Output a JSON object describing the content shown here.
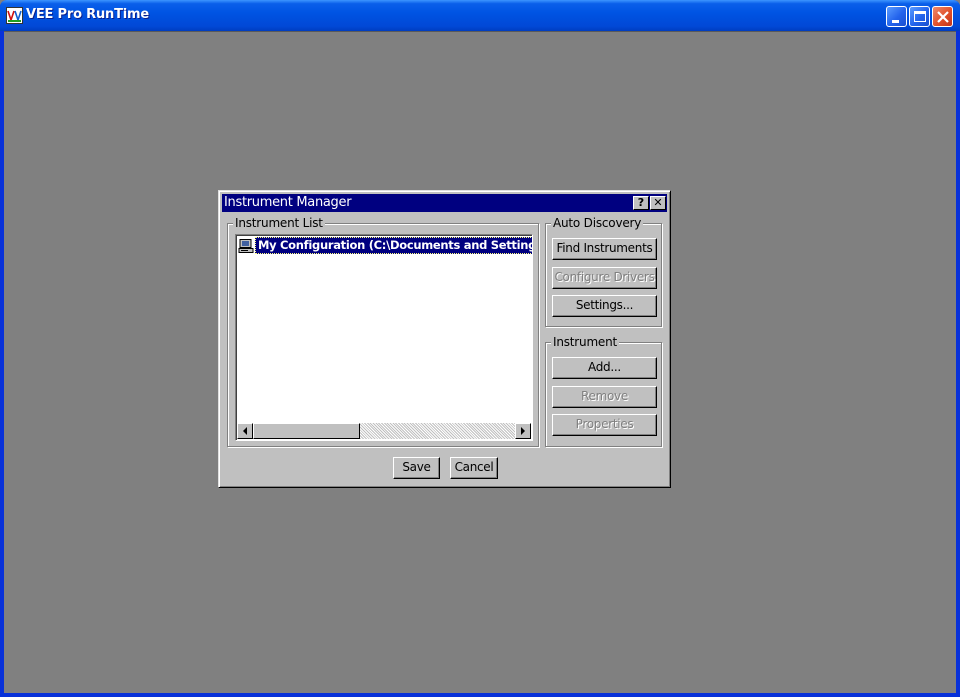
{
  "app": {
    "title": "VEE Pro RunTime",
    "window_controls": [
      "minimize-icon",
      "maximize-icon",
      "close-icon"
    ]
  },
  "dialog": {
    "title": "Instrument Manager",
    "help_label": "?",
    "close_label": "✕",
    "instrument_list": {
      "label": "Instrument List",
      "items": [
        {
          "icon": "configuration-icon",
          "text": "My Configuration (C:\\Documents and Settings\\HP_",
          "selected": true
        }
      ],
      "scrollbar": {
        "thumb_position": 0.0
      }
    },
    "auto_discovery": {
      "label": "Auto Discovery",
      "find_label": "Find Instruments",
      "configure_label": "Configure Drivers",
      "settings_label": "Settings..."
    },
    "instrument": {
      "label": "Instrument",
      "add_label": "Add...",
      "remove_label": "Remove",
      "properties_label": "Properties"
    },
    "save_label": "Save",
    "cancel_label": "Cancel"
  },
  "colors": {
    "xp_title_blue": "#0054e3",
    "desktop_gray": "#808080",
    "dialog_face": "#c0c0c0",
    "dialog_title": "#000080",
    "selection": "#000080",
    "close_red": "#e0502a"
  }
}
